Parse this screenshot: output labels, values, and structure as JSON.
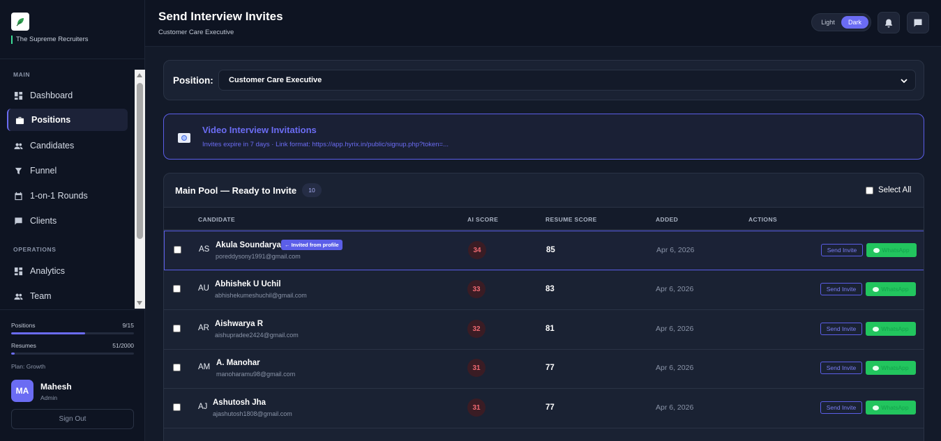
{
  "brand": {
    "name": "The Supreme Recruiters"
  },
  "sidebar": {
    "sections": {
      "main": "MAIN",
      "operations": "OPERATIONS"
    },
    "items": [
      {
        "label": "Dashboard",
        "icon": "dashboard-icon"
      },
      {
        "label": "Positions",
        "icon": "briefcase-icon",
        "active": true
      },
      {
        "label": "Candidates",
        "icon": "users-icon"
      },
      {
        "label": "Funnel",
        "icon": "funnel-icon"
      },
      {
        "label": "1-on-1 Rounds",
        "icon": "calendar-icon"
      },
      {
        "label": "Clients",
        "icon": "chat-icon"
      },
      {
        "label": "Analytics",
        "icon": "analytics-icon"
      },
      {
        "label": "Team",
        "icon": "team-icon"
      }
    ],
    "usage": {
      "positions": {
        "label": "Positions",
        "value": "9/15",
        "fraction": 0.6
      },
      "resumes": {
        "label": "Resumes",
        "value": "51/2000",
        "fraction": 0.026
      }
    },
    "plan": "Plan: Growth",
    "user": {
      "initials": "MA",
      "name": "Mahesh",
      "role": "Admin"
    },
    "signout": "Sign Out"
  },
  "header": {
    "title": "Send Interview Invites",
    "subtitle": "Customer Care Executive",
    "theme": {
      "light": "Light",
      "dark": "Dark"
    }
  },
  "position": {
    "label": "Position:",
    "selected": "Customer Care Executive"
  },
  "info": {
    "title": "Video Interview Invitations",
    "subtitle": "Invites expire in 7 days · Link format: https://app.hyrix.in/public/signup.php?token=..."
  },
  "pool": {
    "title": "Main Pool — Ready to Invite",
    "count": "10",
    "select_all": "Select All",
    "columns": {
      "candidate": "CANDIDATE",
      "ai_score": "AI SCORE",
      "resume_score": "RESUME SCORE",
      "added": "ADDED",
      "actions": "ACTIONS"
    },
    "send_label": "Send Invite",
    "whatsapp_label": "WhatsApp",
    "rows": [
      {
        "initials": "AS",
        "name": "Akula Soundarya",
        "email": "poreddysony1991@gmail.com",
        "tag": "← Invited from profile",
        "ai_score": "34",
        "resume_score": "85",
        "added": "Apr 6, 2026"
      },
      {
        "initials": "AU",
        "name": "Abhishek U Uchil",
        "email": "abhishekumeshuchil@gmail.com",
        "ai_score": "33",
        "resume_score": "83",
        "added": "Apr 6, 2026"
      },
      {
        "initials": "AR",
        "name": "Aishwarya R",
        "email": "aishupradee2424@gmail.com",
        "ai_score": "32",
        "resume_score": "81",
        "added": "Apr 6, 2026"
      },
      {
        "initials": "AM",
        "name": "A. Manohar",
        "email": "manoharamu98@gmail.com",
        "ai_score": "31",
        "resume_score": "77",
        "added": "Apr 6, 2026"
      },
      {
        "initials": "AJ",
        "name": "Ashutosh Jha",
        "email": "ajashutosh1808@gmail.com",
        "ai_score": "31",
        "resume_score": "77",
        "added": "Apr 6, 2026"
      }
    ]
  },
  "colors": {
    "accent": "#6b6cf3",
    "whatsapp": "#22c55e",
    "score_bad": "#f06a72"
  }
}
